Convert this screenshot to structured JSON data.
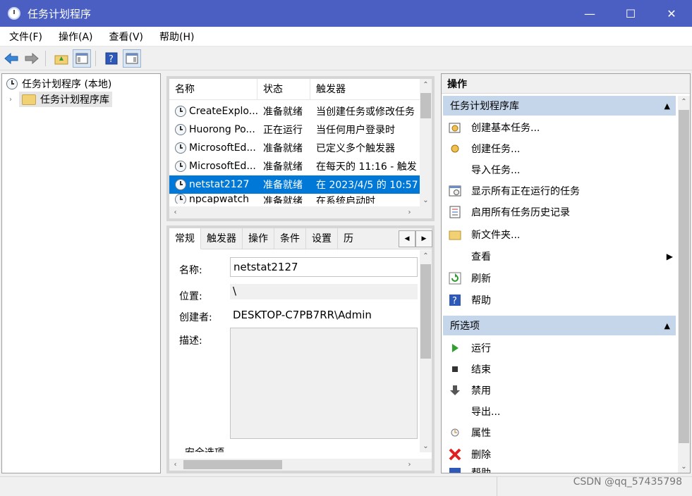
{
  "window": {
    "title": "任务计划程序"
  },
  "menu": [
    "文件(F)",
    "操作(A)",
    "查看(V)",
    "帮助(H)"
  ],
  "tree": {
    "root": "任务计划程序 (本地)",
    "library": "任务计划程序库"
  },
  "task_list": {
    "columns": [
      "名称",
      "状态",
      "触发器"
    ],
    "rows": [
      {
        "name": "CreateExplo...",
        "status": "准备就绪",
        "trigger": "当创建任务或修改任务"
      },
      {
        "name": "Huorong Po...",
        "status": "正在运行",
        "trigger": "当任何用户登录时"
      },
      {
        "name": "MicrosoftEd...",
        "status": "准备就绪",
        "trigger": "已定义多个触发器"
      },
      {
        "name": "MicrosoftEd...",
        "status": "准备就绪",
        "trigger": "在每天的 11:16 - 触发"
      },
      {
        "name": "netstat2127",
        "status": "准备就绪",
        "trigger": "在 2023/4/5 的 10:57"
      },
      {
        "name": "npcapwatch",
        "status": "准备就绪",
        "trigger": "在系统启动时"
      }
    ],
    "selected_index": 4
  },
  "details": {
    "tabs": [
      "常规",
      "触发器",
      "操作",
      "条件",
      "设置",
      "历"
    ],
    "name_label": "名称:",
    "name_value": "netstat2127",
    "location_label": "位置:",
    "location_value": "\\",
    "author_label": "创建者:",
    "author_value": "DESKTOP-C7PB7RR\\Admin",
    "desc_label": "描述:",
    "security_label": "安全选项"
  },
  "actions": {
    "header": "操作",
    "section1": "任务计划程序库",
    "items1": [
      "创建基本任务...",
      "创建任务...",
      "导入任务...",
      "显示所有正在运行的任务",
      "启用所有任务历史记录",
      "新文件夹...",
      "查看",
      "刷新",
      "帮助"
    ],
    "section2": "所选项",
    "items2": [
      "运行",
      "结束",
      "禁用",
      "导出...",
      "属性",
      "删除",
      "帮助"
    ]
  },
  "watermark": "CSDN @qq_57435798"
}
